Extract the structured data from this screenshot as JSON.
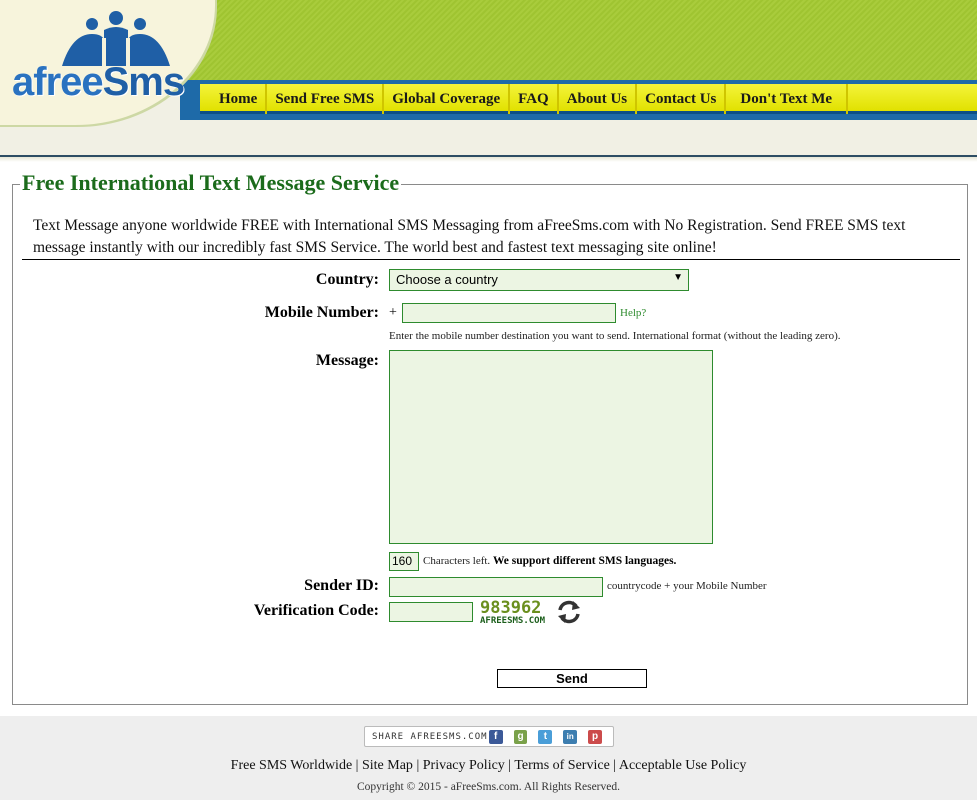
{
  "brand": {
    "logo_prefix": "afree",
    "logo_suffix": "Sms"
  },
  "nav": {
    "items": [
      "Home",
      "Send Free SMS",
      "Global Coverage",
      "FAQ",
      "About Us",
      "Contact Us",
      "Don't Text Me"
    ]
  },
  "main": {
    "title": "Free International Text Message Service",
    "intro": "Text Message anyone worldwide FREE with International SMS Messaging from aFreeSms.com with No Registration. Send FREE SMS text message instantly with our incredibly fast SMS Service. The world best and fastest text messaging site online!"
  },
  "form": {
    "country_label": "Country:",
    "country_selected": "Choose a country",
    "mobile_label": "Mobile Number:",
    "mobile_prefix": "+",
    "mobile_value": "",
    "help_link": "Help?",
    "mobile_hint": "Enter the mobile number destination you want to send. International format (without the leading zero).",
    "message_label": "Message:",
    "message_value": "",
    "chars_left_value": "160",
    "chars_left_text": "Characters left.",
    "chars_support_text": "We support different SMS languages.",
    "sender_label": "Sender ID:",
    "sender_value": "",
    "sender_hint": "countrycode + your Mobile Number",
    "verification_label": "Verification Code:",
    "verification_value": "",
    "captcha_code": "983962",
    "captcha_domain": "AFREESMS.COM",
    "send_label": "Send"
  },
  "footer": {
    "share_label": "SHARE AFREESMS.COM",
    "share_icons": [
      {
        "name": "facebook-icon",
        "glyph": "f",
        "color": "#3b5998"
      },
      {
        "name": "google-plus-icon",
        "glyph": "g",
        "color": "#7aa14a"
      },
      {
        "name": "twitter-icon",
        "glyph": "t",
        "color": "#4a9ed8"
      },
      {
        "name": "linkedin-icon",
        "glyph": "in",
        "color": "#3d7eb0"
      },
      {
        "name": "pinterest-icon",
        "glyph": "p",
        "color": "#cc4b4b"
      }
    ],
    "links": [
      "Free SMS Worldwide",
      "Site Map",
      "Privacy Policy",
      "Terms of Service",
      "Acceptable Use Policy"
    ],
    "copyright": "Copyright © 2015 - aFreeSms.com. All Rights Reserved."
  },
  "colors": {
    "header_green": "#a9cc3c",
    "nav_yellow": "#f4f43a",
    "nav_blue": "#1e6aa8",
    "title_green": "#1b6b1b",
    "field_bg": "#ecf5e3",
    "field_border": "#2e8b2e"
  }
}
